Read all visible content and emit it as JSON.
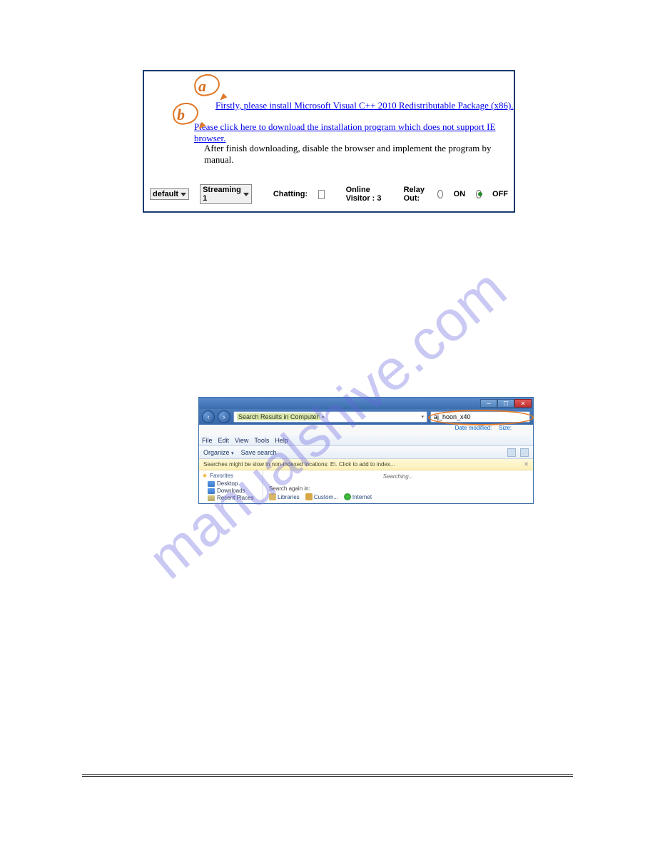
{
  "box1": {
    "linkA": "Firstly, please install Microsoft Visual C++ 2010 Redistributable Package (x86).",
    "linkB": "Please click here to download the installation program which does not support IE browser.",
    "manualText": "After finish downloading, disable the browser and implement the program by manual.",
    "annotationA": "a",
    "annotationB": "b",
    "selectDefault": "default",
    "selectStreaming": "Streaming 1",
    "chattingLabel": "Chatting:",
    "onlineVisitorLabel": "Online Visitor : 3",
    "relayOutLabel": "Relay Out:",
    "onLabel": "ON",
    "offLabel": "OFF"
  },
  "box2": {
    "navBack": "‹",
    "navFwd": "›",
    "addrSeg": "Search Results in Computer",
    "addrArrow1": "▸",
    "addrArrow2": "▾",
    "searchValue": "aj_hoon_x40",
    "filterDate": "Date modified:",
    "filterSize": "Size:",
    "menuFile": "File",
    "menuEdit": "Edit",
    "menuView": "View",
    "menuTools": "Tools",
    "menuHelp": "Help",
    "toolOrganize": "Organize",
    "toolSave": "Save search",
    "infoText": "Searches might be slow in non-indexed locations: E\\. Click to add to index...",
    "infoClose": "✕",
    "favHeader": "Favorites",
    "favDesktop": "Desktop",
    "favDownloads": "Downloads",
    "favRecent": "Recent Places",
    "searchingText": "Searching...",
    "searchAgainLabel": "Search again in:",
    "optLibraries": "Libraries",
    "optCustom": "Custom...",
    "optInternet": "Internet"
  },
  "watermark": "manualshive.com"
}
